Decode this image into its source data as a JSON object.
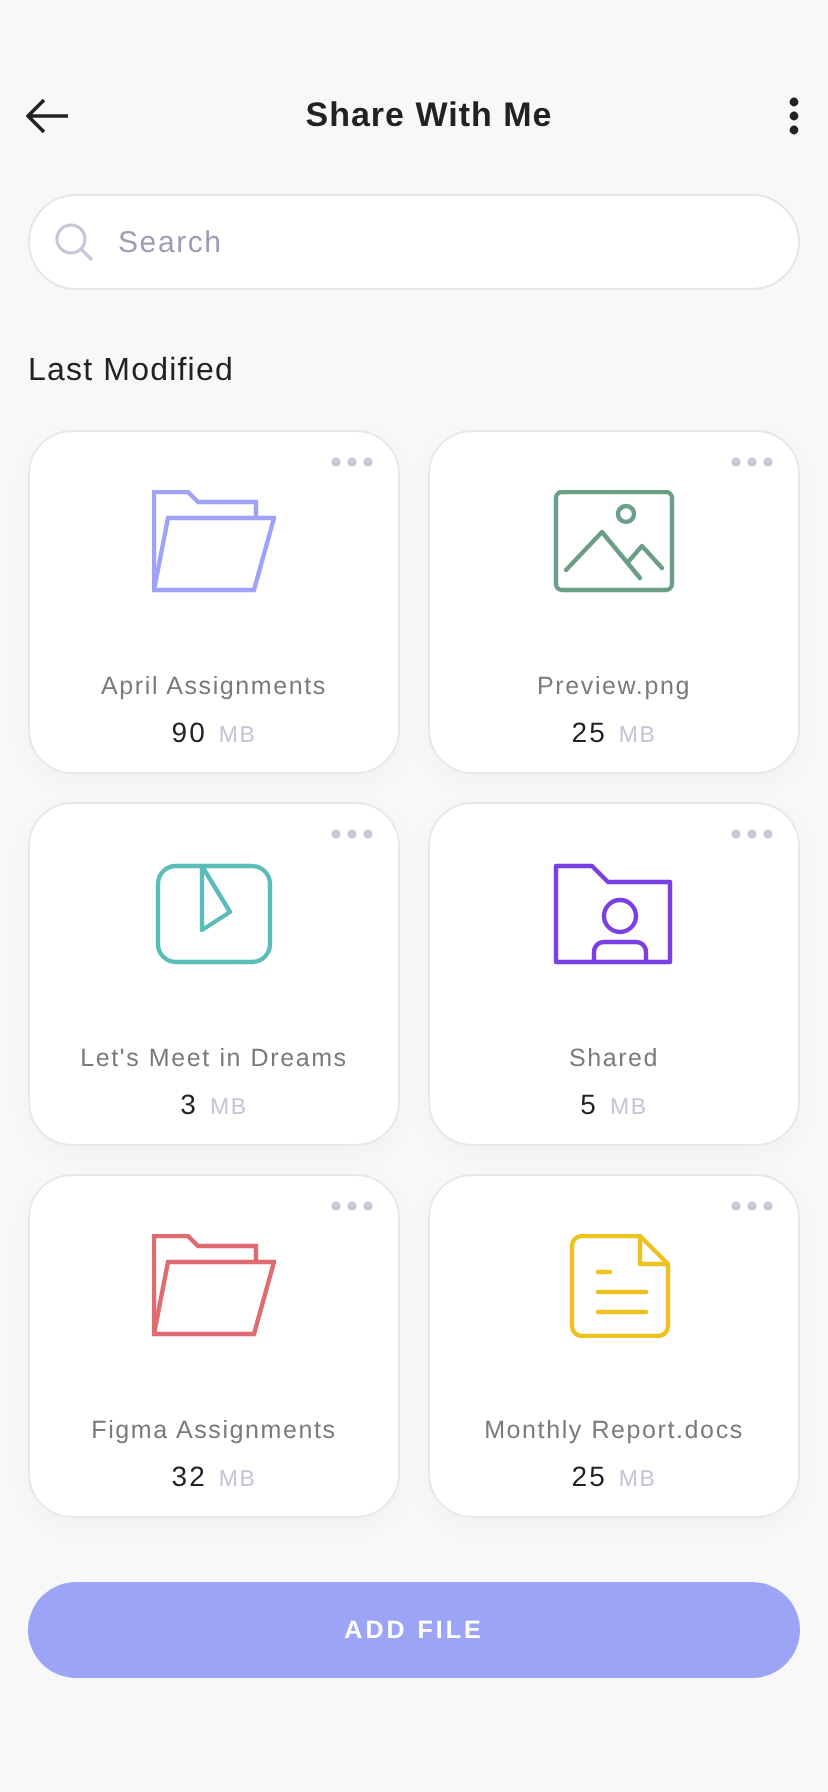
{
  "header": {
    "title": "Share With Me"
  },
  "search": {
    "placeholder": "Search"
  },
  "section_title": "Last Modified",
  "files": [
    {
      "name": "April Assignments",
      "size": "90",
      "unit": "MB",
      "kind": "folder",
      "color": "#9ea3f5"
    },
    {
      "name": "Preview.png",
      "size": "25",
      "unit": "MB",
      "kind": "image",
      "color": "#6a9e85"
    },
    {
      "name": "Let's Meet in Dreams",
      "size": "3",
      "unit": "MB",
      "kind": "video",
      "color": "#5bbcba"
    },
    {
      "name": "Shared",
      "size": "5",
      "unit": "MB",
      "kind": "shared-folder",
      "color": "#7b3fe4"
    },
    {
      "name": "Figma Assignments",
      "size": "32",
      "unit": "MB",
      "kind": "folder",
      "color": "#e06b70"
    },
    {
      "name": "Monthly Report.docs",
      "size": "25",
      "unit": "MB",
      "kind": "document",
      "color": "#eec21e"
    }
  ],
  "add_button": "ADD FILE"
}
